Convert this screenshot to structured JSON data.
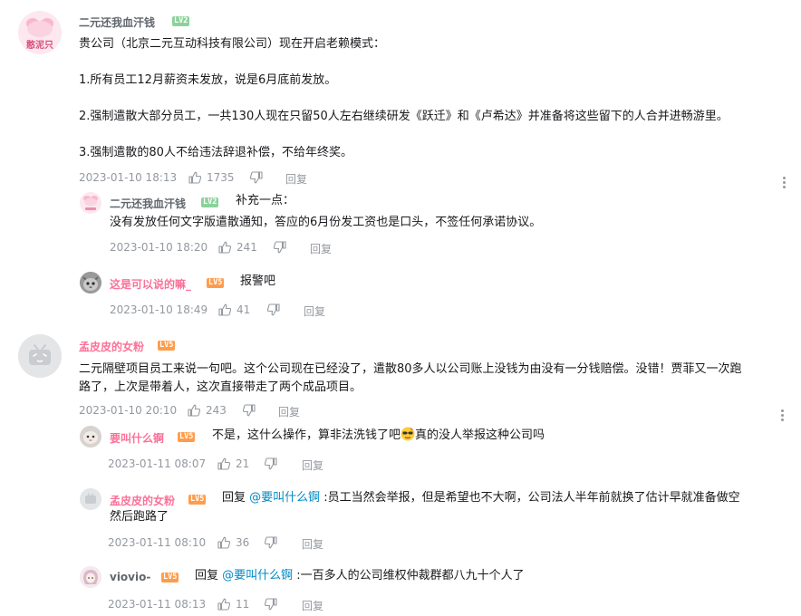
{
  "comments": [
    {
      "user": "二元还我血汗钱",
      "level": "LV2",
      "avatar_text": "憨泥只",
      "lines": [
        "贵公司（北京二元互动科技有限公司）现在开启老赖模式：",
        "1.所有员工12月薪资未发放，说是6月底前发放。",
        "2.强制遣散大部分员工，一共130人现在只留50人左右继续研发《跃迁》和《卢希达》并准备将这些留下的人合并进畅游里。",
        "3.强制遣散的80人不给违法辞退补偿，不给年终奖。"
      ],
      "time": "2023-01-10 18:13",
      "likes": "1735",
      "reply_label": "回复",
      "replies": [
        {
          "user": "二元还我血汗钱",
          "level": "LV2",
          "avatar_text": "憨泥只",
          "prefix": "补充一点：",
          "text": "没有发放任何文字版遣散通知，答应的6月份发工资也是口头，不签任何承诺协议。",
          "time": "2023-01-10 18:20",
          "likes": "241",
          "reply_label": "回复"
        },
        {
          "user": "这是可以说的嘛_",
          "level": "LV5",
          "text": "报警吧",
          "time": "2023-01-10 18:49",
          "likes": "41",
          "reply_label": "回复"
        }
      ]
    },
    {
      "user": "孟皮皮的女粉",
      "level": "LV5",
      "line1": "二元隔壁项目员工来说一句吧。这个公司现在已经没了，遣散80多人以公司账上没钱为由没有一分钱赔偿。没错！贾菲又一次跑",
      "line2": "路了，上次是带着人，这次直接带走了两个成品项目。",
      "time": "2023-01-10 20:10",
      "likes": "243",
      "reply_label": "回复",
      "replies": [
        {
          "user": "要叫什么锕",
          "level": "LV5",
          "text_a": "不是，这什么操作，算非法洗钱了吧",
          "text_b": "真的没人举报这种公司吗",
          "time": "2023-01-11 08:07",
          "likes": "21",
          "reply_label": "回复"
        },
        {
          "user": "孟皮皮的女粉",
          "level": "LV5",
          "reply_word": "回复",
          "at": "@要叫什么锕",
          "line1": " :员工当然会举报，但是希望也不大啊，公司法人半年前就换了估计早就准备做空",
          "line2": "然后跑路了",
          "time": "2023-01-11 08:10",
          "likes": "36",
          "reply_label": "回复"
        },
        {
          "user": "viovio-",
          "level": "LV5",
          "reply_word": "回复",
          "at": "@要叫什么锕",
          "text": " :一百多人的公司维权仲裁群都八九十个人了",
          "time": "2023-01-11 08:13",
          "likes": "11",
          "reply_label": "回复"
        }
      ]
    }
  ],
  "colors": {
    "username": "#61666d",
    "username_vip": "#fb7299",
    "meta": "#9499a0",
    "text": "#18191c",
    "link": "#008ac5",
    "lv2": "#8bd29b",
    "lv5": "#ff9c4b"
  },
  "icons": [
    "like-icon",
    "dislike-icon",
    "more-icon",
    "cool-emoji-icon"
  ]
}
